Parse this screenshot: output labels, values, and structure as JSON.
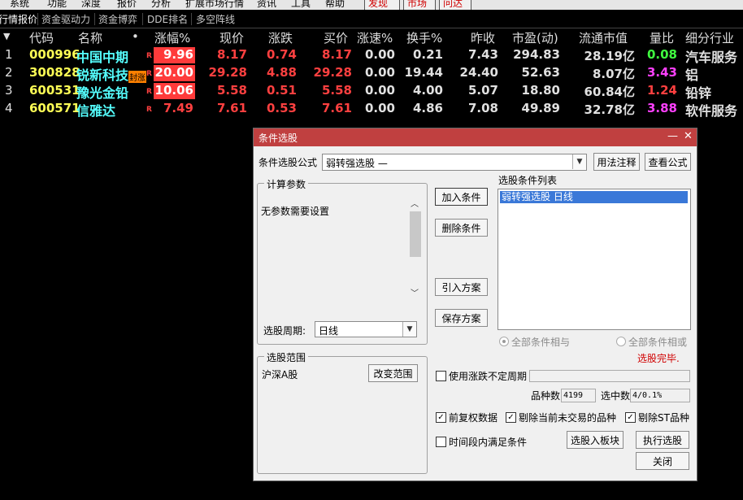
{
  "menubar": {
    "items": [
      "系统",
      "功能",
      "深度",
      "报价",
      "分析",
      "扩展市场行情",
      "资讯",
      "工具",
      "帮助"
    ],
    "discover": "发现",
    "market": "市场",
    "ask": "问达"
  },
  "tabs": [
    "行情报价",
    "资金驱动力",
    "资金博弈",
    "DDE排名",
    "多空阵线"
  ],
  "table": {
    "headers": {
      "code": "代码",
      "name": "名称",
      "dot": "•",
      "change_pct": "涨幅%",
      "price": "现价",
      "change": "涨跌",
      "bid": "买价",
      "speed": "涨速%",
      "turnover": "换手%",
      "prev_close": "昨收",
      "pe": "市盈(动)",
      "float_mv": "流通市值",
      "vol_ratio": "量比",
      "industry": "细分行业"
    },
    "rows": [
      {
        "idx": "1",
        "code": "000996",
        "name": "中国中期",
        "r": "R",
        "tag": "",
        "change_pct": "9.96",
        "price": "8.17",
        "change": "0.74",
        "bid": "8.17",
        "speed": "0.00",
        "turnover": "0.21",
        "prev_close": "7.43",
        "pe": "294.83",
        "float_mv": "28.19亿",
        "vol_ratio": "0.08",
        "industry": "汽车服务"
      },
      {
        "idx": "2",
        "code": "300828",
        "name": "锐新科技",
        "r": "R",
        "tag": "封涨",
        "change_pct": "20.00",
        "price": "29.28",
        "change": "4.88",
        "bid": "29.28",
        "speed": "0.00",
        "turnover": "19.44",
        "prev_close": "24.40",
        "pe": "52.63",
        "float_mv": "8.07亿",
        "vol_ratio": "3.43",
        "industry": "铝"
      },
      {
        "idx": "3",
        "code": "600531",
        "name": "豫光金铅",
        "r": "R",
        "tag": "",
        "change_pct": "10.06",
        "price": "5.58",
        "change": "0.51",
        "bid": "5.58",
        "speed": "0.00",
        "turnover": "4.00",
        "prev_close": "5.07",
        "pe": "18.80",
        "float_mv": "60.84亿",
        "vol_ratio": "1.24",
        "industry": "铅锌"
      },
      {
        "idx": "4",
        "code": "600571",
        "name": "信雅达",
        "r": "R",
        "tag": "",
        "change_pct": "7.49",
        "price": "7.61",
        "change": "0.53",
        "bid": "7.61",
        "speed": "0.00",
        "turnover": "4.86",
        "prev_close": "7.08",
        "pe": "49.89",
        "float_mv": "32.78亿",
        "vol_ratio": "3.88",
        "industry": "软件服务"
      }
    ]
  },
  "dialog": {
    "title": "条件选股",
    "minimize": "—",
    "close": "✕",
    "formula_label": "条件选股公式",
    "formula_value": "弱转强选股    —",
    "usage_btn": "用法注释",
    "view_formula_btn": "查看公式",
    "calc_params_title": "计算参数",
    "no_params": "无参数需要设置",
    "period_label": "选股周期:",
    "period_value": "日线",
    "range_title": "选股范围",
    "range_value": "沪深A股",
    "change_range_btn": "改变范围",
    "add_cond_btn": "加入条件",
    "delete_cond_btn": "删除条件",
    "import_btn": "引入方案",
    "save_btn": "保存方案",
    "cond_list_label": "选股条件列表",
    "cond_items": [
      "弱转强选股  日线"
    ],
    "all_and": "全部条件相与",
    "all_or": "全部条件相或",
    "status": "选股完毕.",
    "use_period_label": "使用涨跌不定周期",
    "count_label": "品种数",
    "count_value": "4199",
    "selected_label": "选中数",
    "selected_value": "4/0.1%",
    "prev_adj_label": "前复权数据",
    "exclude_untraded_label": "剔除当前未交易的品种",
    "exclude_st_label": "剔除ST品种",
    "time_period_label": "时间段内满足条件",
    "to_block_btn": "选股入板块",
    "execute_btn": "执行选股",
    "close_btn": "关闭",
    "check_mark": "✓",
    "scroll_up": "︿",
    "scroll_down": "﹀",
    "combo_arrow": "▼"
  },
  "colors": {
    "up": "#ff3b3b",
    "code": "#ffff55",
    "name": "#55ffff",
    "titlebar": "#c04040",
    "selection": "#3a78d8"
  }
}
